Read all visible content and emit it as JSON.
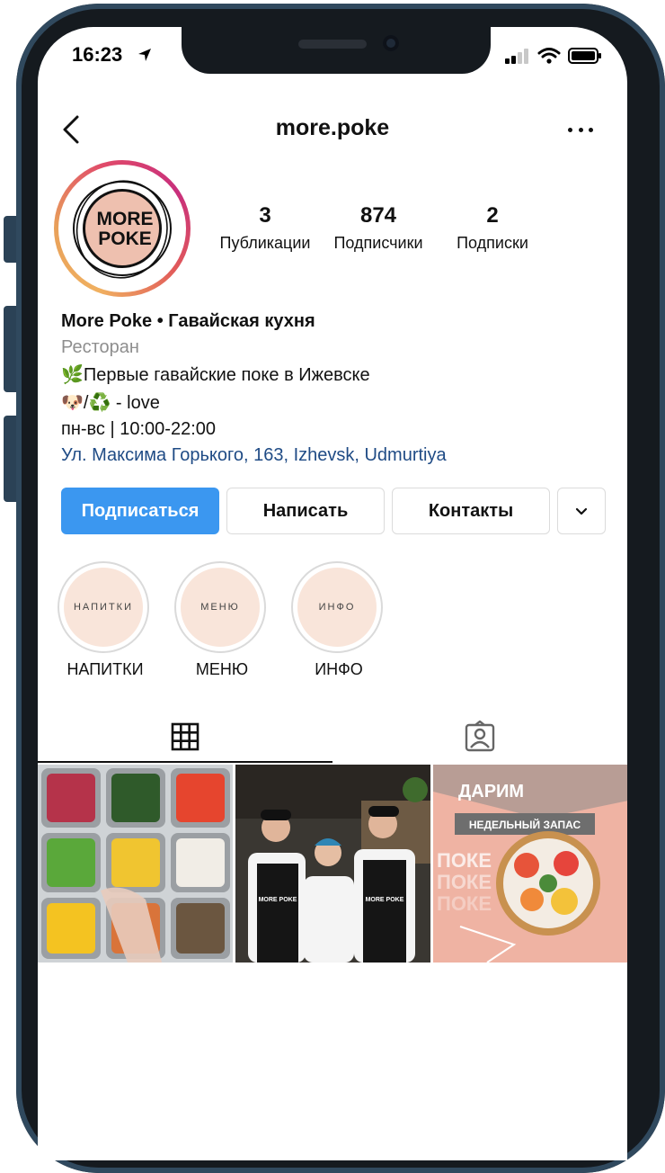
{
  "status_bar": {
    "time": "16:23"
  },
  "header": {
    "username": "more.poke"
  },
  "profile": {
    "logo_text_line1": "MORE",
    "logo_text_line2": "POKE",
    "stats": [
      {
        "number": "3",
        "label": "Публикации"
      },
      {
        "number": "874",
        "label": "Подписчики"
      },
      {
        "number": "2",
        "label": "Подписки"
      }
    ]
  },
  "bio": {
    "name": "More Poke • Гавайская кухня",
    "category": "Ресторан",
    "line1": "🌿Первые гавайские поке в Ижевске",
    "line2": "🐶/♻️  - love",
    "hours": "пн-вс | 10:00-22:00",
    "address": "Ул. Максима Горького, 163, Izhevsk, Udmurtiya"
  },
  "buttons": {
    "follow": "Подписаться",
    "message": "Написать",
    "contacts": "Контакты"
  },
  "highlights": [
    {
      "cover": "НАПИТКИ",
      "label": "НАПИТКИ"
    },
    {
      "cover": "МЕНЮ",
      "label": "МЕНЮ"
    },
    {
      "cover": "ИНФО",
      "label": "ИНФО"
    }
  ],
  "posts": {
    "post3_title": "ДАРИМ",
    "post3_banner": "НЕДЕЛЬНЫЙ ЗАПАС",
    "post3_bg_text": "ПОКЕ",
    "post2_apron_text": "MORE POKE"
  },
  "colors": {
    "accent": "#3b97f0",
    "link": "#1f4b85",
    "highlight_bg": "#f9e5da",
    "logo_bg": "#eec0af"
  }
}
